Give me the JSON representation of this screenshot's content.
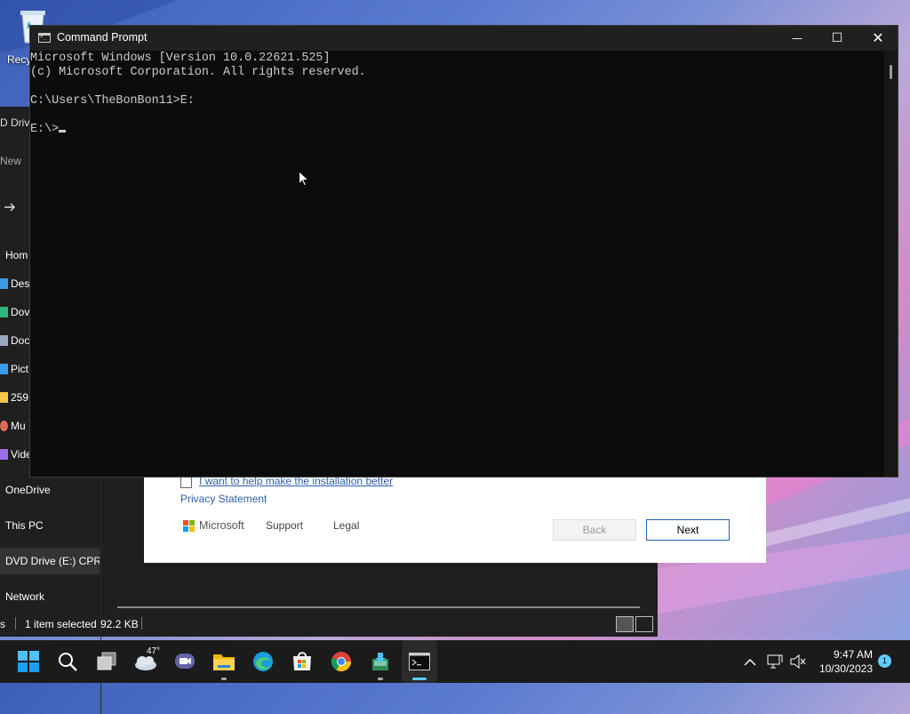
{
  "desktop": {
    "recycle_label": "Recy"
  },
  "explorer": {
    "header_fragments": {
      "dvd": "D Drive",
      "new": "New"
    },
    "sidebar": [
      {
        "label": "Hom",
        "icon": "home-icon",
        "color": ""
      },
      {
        "label": "Des",
        "icon": "desktop-folder-icon",
        "color": "#3a9be8"
      },
      {
        "label": "Dov",
        "icon": "downloads-icon",
        "color": "#2fb67c"
      },
      {
        "label": "Doc",
        "icon": "documents-icon",
        "color": "#9aa9bd"
      },
      {
        "label": "Pict",
        "icon": "pictures-icon",
        "color": "#3a9be8"
      },
      {
        "label": "259",
        "icon": "folder-icon",
        "color": "#f3c74a"
      },
      {
        "label": "Mu",
        "icon": "music-icon",
        "color": "#e06a5a"
      },
      {
        "label": "Vide",
        "icon": "videos-icon",
        "color": "#9a6ee8"
      },
      {
        "label": "OneDrive",
        "icon": "",
        "color": ""
      },
      {
        "label": "This PC",
        "icon": "",
        "color": ""
      },
      {
        "label": "DVD Drive (E:) CPRA",
        "icon": "",
        "color": ""
      },
      {
        "label": "Network",
        "icon": "",
        "color": ""
      }
    ],
    "status": {
      "items_fragment": "s",
      "selected": "1 item selected",
      "size": "92.2 KB"
    }
  },
  "installer": {
    "checkbox_label": "I want to help make the installation better",
    "privacy": "Privacy Statement",
    "brand": "Microsoft",
    "support": "Support",
    "legal": "Legal",
    "back": "Back",
    "next": "Next"
  },
  "cmd": {
    "title": "Command Prompt",
    "lines": [
      "Microsoft Windows [Version 10.0.22621.525]",
      "(c) Microsoft Corporation. All rights reserved.",
      "",
      "C:\\Users\\TheBonBon11>E:",
      "",
      "E:\\>"
    ],
    "controls": {
      "minimize": "—",
      "maximize": "☐",
      "close": "✕"
    }
  },
  "taskbar": {
    "weather_temp": "47°",
    "time": "9:47 AM",
    "date": "10/30/2023",
    "notification_count": "1"
  },
  "colors": {
    "accent": "#60cdff",
    "taskbar_bg": "#1b1b1b",
    "cmd_bg": "#0c0c0c",
    "link": "#2b5fb2"
  }
}
